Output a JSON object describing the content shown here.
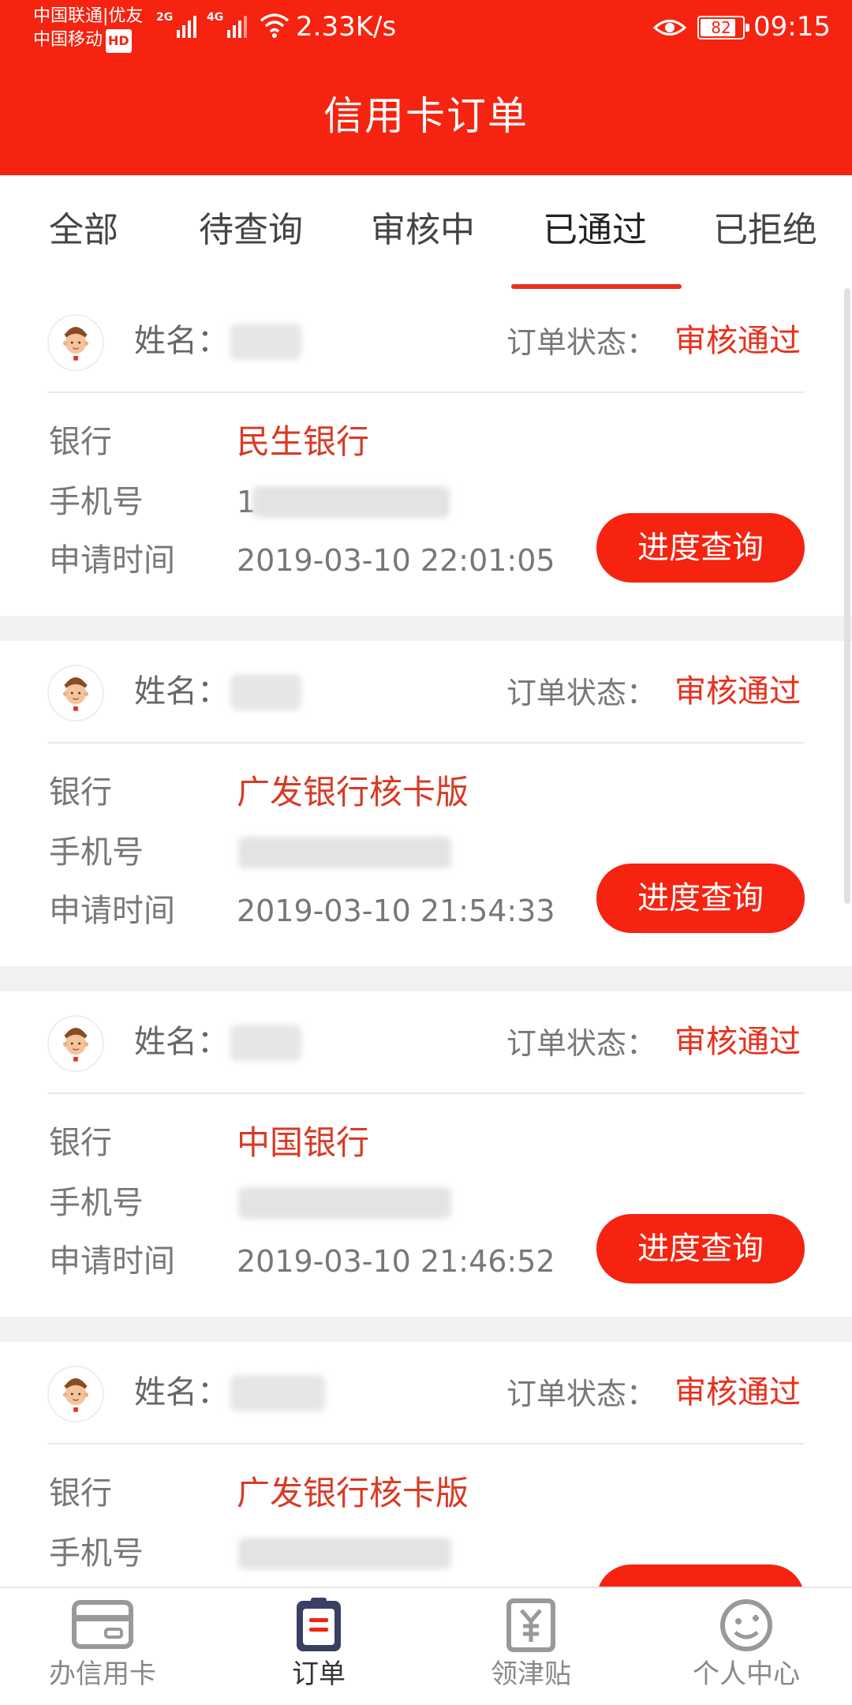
{
  "status_bar": {
    "carrier_1": "中国联通|优友",
    "carrier_2": "中国移动",
    "hd": "HD",
    "net_1": "2G",
    "net_2": "4G",
    "speed": "2.33K/s",
    "battery": "82",
    "time": "09:15"
  },
  "header": {
    "title": "信用卡订单"
  },
  "tabs": [
    {
      "label": "全部"
    },
    {
      "label": "待查询"
    },
    {
      "label": "审核中"
    },
    {
      "label": "已通过"
    },
    {
      "label": "已拒绝"
    }
  ],
  "active_tab": "已通过",
  "labels": {
    "name": "姓名：",
    "order_status": "订单状态：",
    "bank": "银行",
    "phone": "手机号",
    "apply_time": "申请时间",
    "progress_button": "进度查询"
  },
  "orders": [
    {
      "status": "审核通过",
      "bank": "民生银行",
      "phone_prefix": "1",
      "apply_time": "2019-03-10 22:01:05"
    },
    {
      "status": "审核通过",
      "bank": "广发银行核卡版",
      "phone_prefix": "",
      "apply_time": "2019-03-10 21:54:33"
    },
    {
      "status": "审核通过",
      "bank": "中国银行",
      "phone_prefix": "",
      "apply_time": "2019-03-10 21:46:52"
    },
    {
      "status": "审核通过",
      "bank": "广发银行核卡版",
      "phone_prefix": "",
      "apply_time": ""
    }
  ],
  "bottom_nav": [
    {
      "label": "办信用卡",
      "icon": "card-icon"
    },
    {
      "label": "订单",
      "icon": "clipboard-icon"
    },
    {
      "label": "领津贴",
      "icon": "yen-icon"
    },
    {
      "label": "个人中心",
      "icon": "smiley-icon"
    }
  ],
  "colors": {
    "accent": "#f5230f",
    "bank_text": "#d83a25"
  }
}
